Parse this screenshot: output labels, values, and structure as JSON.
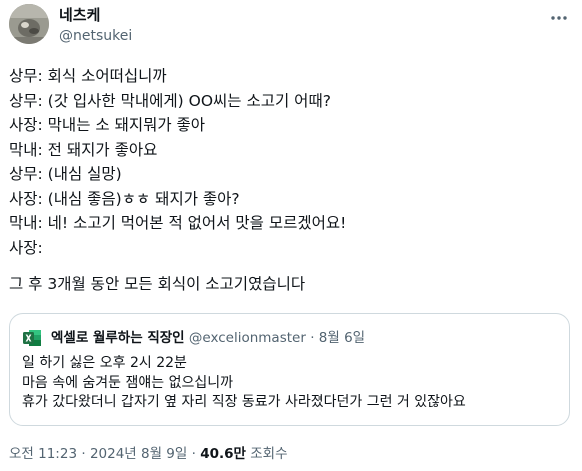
{
  "author": {
    "name": "네츠케",
    "handle": "@netsukei",
    "avatar_icon": "profile-photo"
  },
  "more_icon": "ellipsis-horizontal-icon",
  "tweet_lines": [
    "상무: 회식 소어떠십니까",
    "상무: (갓 입사한 막내에게) OO씨는 소고기 어때?",
    "사장: 막내는 소 돼지뭐가 좋아",
    "막내: 전 돼지가 좋아요",
    "상무: (내심 실망)",
    "사장: (내심 좋음)ㅎㅎ 돼지가 좋아?",
    "막내: 네! 소고기 먹어본 적 없어서 맛을 모르겠어요!",
    "사장:"
  ],
  "tweet_conclusion": "그 후 3개월 동안 모든 회식이 소고기였습니다",
  "quote": {
    "name": "엑셀로 월루하는 직장인",
    "handle": "@excelionmaster",
    "separator": "·",
    "date": "8월 6일",
    "avatar_icon": "excel-icon",
    "lines": [
      "일 하기 싫은 오후 2시 22분",
      "마음 속에 숨겨둔 잼얘는 없으십니까",
      "휴가 갔다왔더니 갑자기 옆 자리 직장 동료가 사라졌다던가 그런 거 있잖아요"
    ]
  },
  "meta": {
    "time": "오전 11:23",
    "separator": "·",
    "date": "2024년 8월 9일",
    "views_count": "40.6만",
    "views_label": "조회수"
  },
  "colors": {
    "text_primary": "#0f1419",
    "text_secondary": "#536471",
    "border": "#cfd9de",
    "excel_green": "#1f7244"
  }
}
